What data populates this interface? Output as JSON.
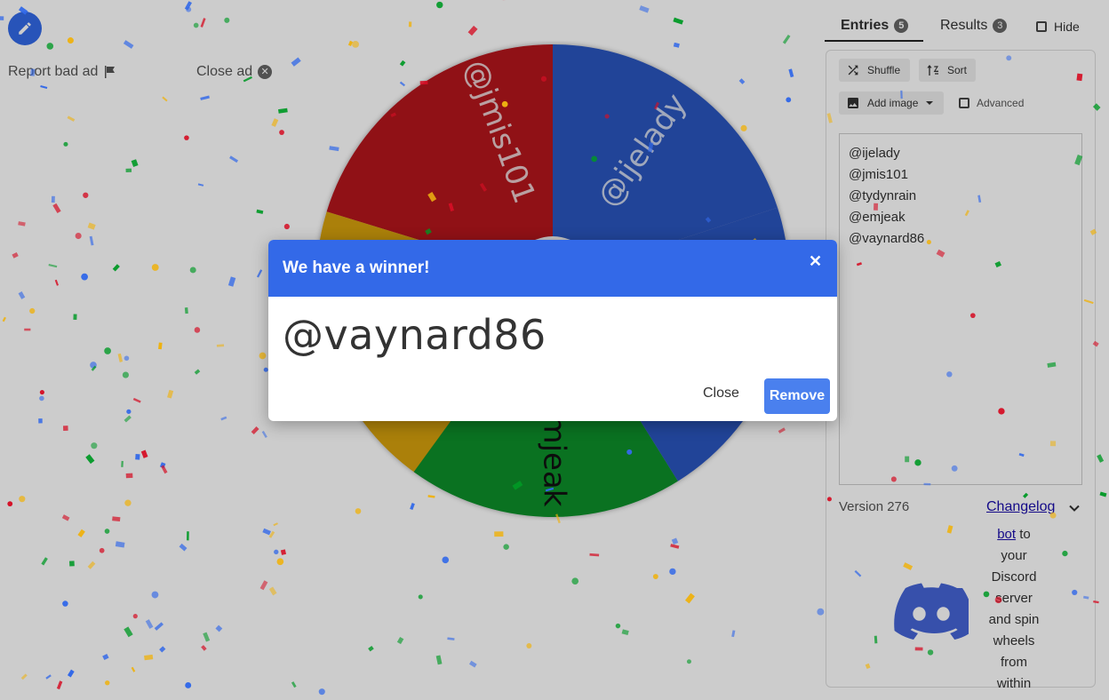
{
  "ad": {
    "report_label": "Report bad ad",
    "close_label": "Close ad"
  },
  "wheel": {
    "colors": {
      "red": "#b5121b",
      "blue": "#2b55bf",
      "green": "#0c8f2c",
      "yellow": "#d6a00a"
    },
    "labels": [
      "@ijelady",
      "@jmis101",
      "@emjeak"
    ]
  },
  "tabs": {
    "entries_label": "Entries",
    "entries_count": "5",
    "results_label": "Results",
    "results_count": "3",
    "hide_label": "Hide"
  },
  "toolbar": {
    "shuffle_label": "Shuffle",
    "sort_label": "Sort",
    "add_image_label": "Add image",
    "advanced_label": "Advanced"
  },
  "entries": [
    "@ijelady",
    "@jmis101",
    "@tydynrain",
    "@emjeak",
    "@vaynard86"
  ],
  "footer": {
    "version": "Version 276",
    "changelog_label": "Changelog"
  },
  "discord": {
    "link_text": "bot",
    "lines": [
      "to",
      "your",
      "Discord",
      "server",
      "and spin",
      "wheels",
      "from",
      "within"
    ]
  },
  "modal": {
    "title": "We have a winner!",
    "winner": "@vaynard86",
    "close_label": "Close",
    "remove_label": "Remove"
  },
  "colors": {
    "accent": "#3369e8",
    "remove_button": "#4a80ee"
  }
}
